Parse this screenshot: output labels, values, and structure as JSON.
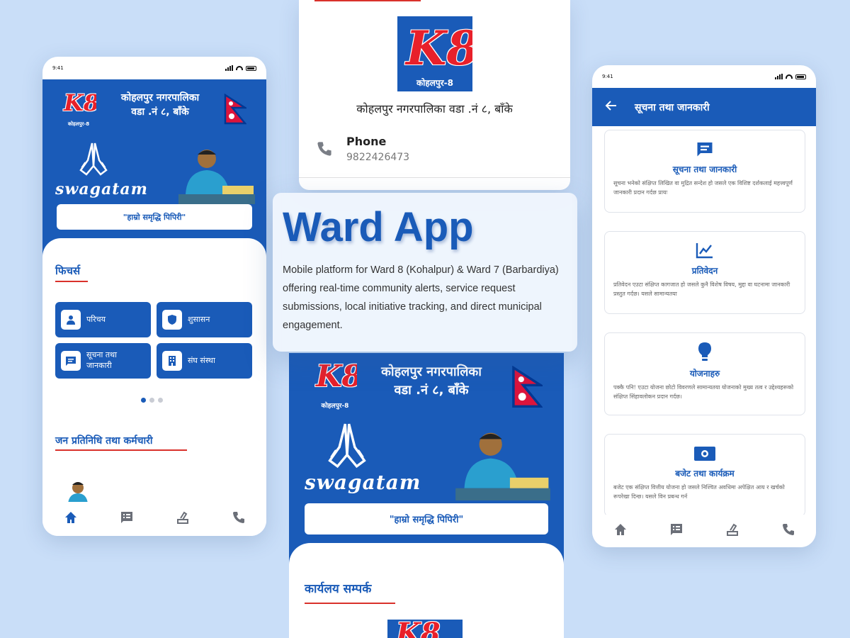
{
  "status_bar": {
    "time": "9:41"
  },
  "left_phone": {
    "header": {
      "title_line1": "कोहलपुर नगरपालिका",
      "title_line2": "वडा .नं ८, बाँके",
      "logo_text": "K8",
      "logo_sub": "कोहलपुर-8",
      "swagatam": "swagatam"
    },
    "slogan": "\"हाम्रो समृद्धि पिपिरी\"",
    "features_heading": "फिचर्स",
    "features": [
      {
        "label": "परिचय",
        "icon": "person-icon"
      },
      {
        "label": "शुसासन",
        "icon": "shield-icon"
      },
      {
        "label": "सूचना तथा जानकारी",
        "icon": "notice-icon"
      },
      {
        "label": "संघ संस्था",
        "icon": "building-icon"
      }
    ],
    "carousel": {
      "active_index": 0,
      "total": 3
    },
    "representatives_heading": "जन प्रतिनिधि तथा कर्मचारी",
    "nav": [
      "home-icon",
      "feed-icon",
      "vote-icon",
      "phone-icon"
    ]
  },
  "center_top": {
    "logo_sub": "कोहलपुर-8",
    "title": "कोहलपुर नगरपालिका वडा .नं ८, बाँके",
    "contact": {
      "label": "Phone",
      "value": "9822426473",
      "icon": "phone-icon"
    }
  },
  "hero": {
    "title": "Ward App",
    "description": "Mobile platform for Ward 8 (Kohalpur) & Ward 7 (Barbardiya) offering real-time community alerts, service request submissions, local initiative tracking, and direct municipal engagement."
  },
  "center_bottom": {
    "header": {
      "title_line1": "कोहलपुर नगरपालिका",
      "title_line2": "वडा .नं ८, बाँके",
      "logo_sub": "कोहलपुर-8",
      "swagatam": "swagatam"
    },
    "slogan": "\"हाम्रो समृद्धि पिपिरी\"",
    "contact_heading": "कार्यलय सम्पर्क"
  },
  "right_phone": {
    "appbar_title": "सूचना तथा जानकारी",
    "cards": [
      {
        "title": "सूचना तथा जानकारी",
        "icon": "notice-icon",
        "text": "सूचना भनेको संक्षिप्त लिखित वा मुद्रित सन्देश हो जसले एक विशिष्ट दर्शकलाई महत्त्वपूर्ण जानकारी प्रदान गर्दछ प्रायः"
      },
      {
        "title": "प्रतिवेदन",
        "icon": "chart-icon",
        "text": "प्रतिवेदन एउटा संक्षिप्त कागजात हो जसले कुनै विशेष विषय, मुद्दा वा घटनामा जानकारी प्रस्तुत गर्दछ। यसले सामान्यतया"
      },
      {
        "title": "योजनाहरु",
        "icon": "bulb-icon",
        "text": "पक्कै पनि! एउटा योजना छोटो विवरणले सामान्यतया योजनाको मुख्य तत्व र उद्देश्यहरूको संक्षिप्त सिंहावलोकन प्रदान गर्दछ।"
      },
      {
        "title": "बजेट तथा कार्यक्रम",
        "icon": "money-icon",
        "text": "बजेट एक संक्षिप्त वित्तीय योजना हो जसले निश्चित अवधिमा अपेक्षित आय र खर्चको रूपरेखा दिन्छ। यसले विन प्रबन्ध गर्न"
      }
    ],
    "nav": [
      "home-icon",
      "feed-icon",
      "vote-icon",
      "phone-icon"
    ]
  },
  "colors": {
    "primary": "#1a5bb8",
    "accent": "#d9312b",
    "background": "#c9def8"
  }
}
